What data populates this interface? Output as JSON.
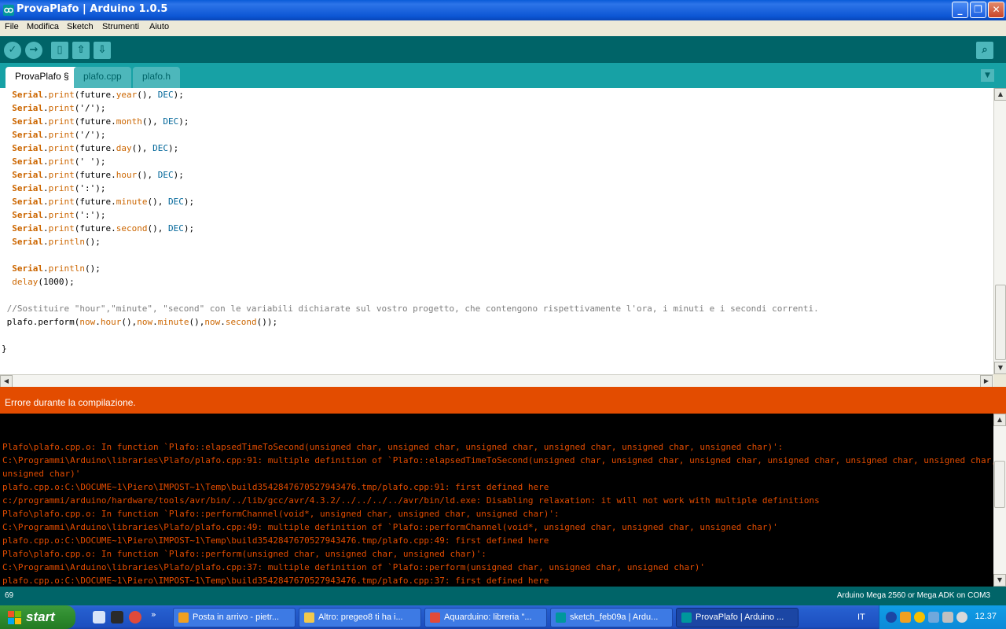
{
  "window": {
    "title": "ProvaPlafo | Arduino 1.0.5"
  },
  "menu": [
    "File",
    "Modifica",
    "Sketch",
    "Strumenti",
    "Aiuto"
  ],
  "tabs": [
    "ProvaPlafo §",
    "plafo.cpp",
    "plafo.h"
  ],
  "code_lines": [
    [
      {
        "t": "  "
      },
      {
        "t": "Serial",
        "c": "kw"
      },
      {
        "t": "."
      },
      {
        "t": "print",
        "c": "fn"
      },
      {
        "t": "(future."
      },
      {
        "t": "year",
        "c": "fn"
      },
      {
        "t": "(), "
      },
      {
        "t": "DEC",
        "c": "cst"
      },
      {
        "t": ");"
      }
    ],
    [
      {
        "t": "  "
      },
      {
        "t": "Serial",
        "c": "kw"
      },
      {
        "t": "."
      },
      {
        "t": "print",
        "c": "fn"
      },
      {
        "t": "('/');"
      }
    ],
    [
      {
        "t": "  "
      },
      {
        "t": "Serial",
        "c": "kw"
      },
      {
        "t": "."
      },
      {
        "t": "print",
        "c": "fn"
      },
      {
        "t": "(future."
      },
      {
        "t": "month",
        "c": "fn"
      },
      {
        "t": "(), "
      },
      {
        "t": "DEC",
        "c": "cst"
      },
      {
        "t": ");"
      }
    ],
    [
      {
        "t": "  "
      },
      {
        "t": "Serial",
        "c": "kw"
      },
      {
        "t": "."
      },
      {
        "t": "print",
        "c": "fn"
      },
      {
        "t": "('/');"
      }
    ],
    [
      {
        "t": "  "
      },
      {
        "t": "Serial",
        "c": "kw"
      },
      {
        "t": "."
      },
      {
        "t": "print",
        "c": "fn"
      },
      {
        "t": "(future."
      },
      {
        "t": "day",
        "c": "fn"
      },
      {
        "t": "(), "
      },
      {
        "t": "DEC",
        "c": "cst"
      },
      {
        "t": ");"
      }
    ],
    [
      {
        "t": "  "
      },
      {
        "t": "Serial",
        "c": "kw"
      },
      {
        "t": "."
      },
      {
        "t": "print",
        "c": "fn"
      },
      {
        "t": "(' ');"
      }
    ],
    [
      {
        "t": "  "
      },
      {
        "t": "Serial",
        "c": "kw"
      },
      {
        "t": "."
      },
      {
        "t": "print",
        "c": "fn"
      },
      {
        "t": "(future."
      },
      {
        "t": "hour",
        "c": "fn"
      },
      {
        "t": "(), "
      },
      {
        "t": "DEC",
        "c": "cst"
      },
      {
        "t": ");"
      }
    ],
    [
      {
        "t": "  "
      },
      {
        "t": "Serial",
        "c": "kw"
      },
      {
        "t": "."
      },
      {
        "t": "print",
        "c": "fn"
      },
      {
        "t": "(':');"
      }
    ],
    [
      {
        "t": "  "
      },
      {
        "t": "Serial",
        "c": "kw"
      },
      {
        "t": "."
      },
      {
        "t": "print",
        "c": "fn"
      },
      {
        "t": "(future."
      },
      {
        "t": "minute",
        "c": "fn"
      },
      {
        "t": "(), "
      },
      {
        "t": "DEC",
        "c": "cst"
      },
      {
        "t": ");"
      }
    ],
    [
      {
        "t": "  "
      },
      {
        "t": "Serial",
        "c": "kw"
      },
      {
        "t": "."
      },
      {
        "t": "print",
        "c": "fn"
      },
      {
        "t": "(':');"
      }
    ],
    [
      {
        "t": "  "
      },
      {
        "t": "Serial",
        "c": "kw"
      },
      {
        "t": "."
      },
      {
        "t": "print",
        "c": "fn"
      },
      {
        "t": "(future."
      },
      {
        "t": "second",
        "c": "fn"
      },
      {
        "t": "(), "
      },
      {
        "t": "DEC",
        "c": "cst"
      },
      {
        "t": ");"
      }
    ],
    [
      {
        "t": "  "
      },
      {
        "t": "Serial",
        "c": "kw"
      },
      {
        "t": "."
      },
      {
        "t": "println",
        "c": "fn"
      },
      {
        "t": "();"
      }
    ],
    [
      {
        "t": ""
      }
    ],
    [
      {
        "t": "  "
      },
      {
        "t": "Serial",
        "c": "kw"
      },
      {
        "t": "."
      },
      {
        "t": "println",
        "c": "fn"
      },
      {
        "t": "();"
      }
    ],
    [
      {
        "t": "  "
      },
      {
        "t": "delay",
        "c": "fn"
      },
      {
        "t": "(1000);"
      }
    ],
    [
      {
        "t": ""
      }
    ],
    [
      {
        "t": " "
      },
      {
        "t": "//Sostituire \"hour\",\"minute\", \"second\" con le variabili dichiarate sul vostro progetto, che contengono rispettivamente l'ora, i minuti e i secondi correnti.",
        "c": "cm"
      }
    ],
    [
      {
        "t": " plafo.perform("
      },
      {
        "t": "now",
        "c": "fn"
      },
      {
        "t": "."
      },
      {
        "t": "hour",
        "c": "fn"
      },
      {
        "t": "(),"
      },
      {
        "t": "now",
        "c": "fn"
      },
      {
        "t": "."
      },
      {
        "t": "minute",
        "c": "fn"
      },
      {
        "t": "(),"
      },
      {
        "t": "now",
        "c": "fn"
      },
      {
        "t": "."
      },
      {
        "t": "second",
        "c": "fn"
      },
      {
        "t": "());"
      }
    ],
    [
      {
        "t": ""
      }
    ],
    [
      {
        "t": "}"
      }
    ]
  ],
  "status": {
    "message": "Errore durante la compilazione."
  },
  "console_lines": [
    "",
    "",
    "Plafo\\plafo.cpp.o: In function `Plafo::elapsedTimeToSecond(unsigned char, unsigned char, unsigned char, unsigned char, unsigned char, unsigned char)':",
    "C:\\Programmi\\Arduino\\libraries\\Plafo/plafo.cpp:91: multiple definition of `Plafo::elapsedTimeToSecond(unsigned char, unsigned char, unsigned char, unsigned char, unsigned char, unsigned char,",
    "unsigned char)'",
    "plafo.cpp.o:C:\\DOCUME~1\\Piero\\IMPOST~1\\Temp\\build3542847670527943476.tmp/plafo.cpp:91: first defined here",
    "c:/programmi/arduino/hardware/tools/avr/bin/../lib/gcc/avr/4.3.2/../../../../avr/bin/ld.exe: Disabling relaxation: it will not work with multiple definitions",
    "Plafo\\plafo.cpp.o: In function `Plafo::performChannel(void*, unsigned char, unsigned char, unsigned char)':",
    "C:\\Programmi\\Arduino\\libraries\\Plafo/plafo.cpp:49: multiple definition of `Plafo::performChannel(void*, unsigned char, unsigned char, unsigned char)'",
    "plafo.cpp.o:C:\\DOCUME~1\\Piero\\IMPOST~1\\Temp\\build3542847670527943476.tmp/plafo.cpp:49: first defined here",
    "Plafo\\plafo.cpp.o: In function `Plafo::perform(unsigned char, unsigned char, unsigned char)':",
    "C:\\Programmi\\Arduino\\libraries\\Plafo/plafo.cpp:37: multiple definition of `Plafo::perform(unsigned char, unsigned char, unsigned char)'",
    "plafo.cpp.o:C:\\DOCUME~1\\Piero\\IMPOST~1\\Temp\\build3542847670527943476.tmp/plafo.cpp:37: first defined here"
  ],
  "footer": {
    "line_number": "69",
    "board": "Arduino Mega 2560 or Mega ADK on COM3"
  },
  "taskbar": {
    "start_label": "start",
    "tasks": [
      {
        "label": "Posta in arrivo - pietr...",
        "icon": "outlook-icon",
        "color": "#f0a020"
      },
      {
        "label": "Altro: pregeo8 ti ha i...",
        "icon": "mail-icon",
        "color": "#f2c94c"
      },
      {
        "label": "Aquarduino: libreria \"...",
        "icon": "chrome-icon",
        "color": "#e04a3a"
      },
      {
        "label": "sketch_feb09a | Ardu...",
        "icon": "arduino-icon",
        "color": "#00979c"
      },
      {
        "label": "ProvaPlafo | Arduino ...",
        "icon": "arduino-icon",
        "color": "#00979c"
      }
    ],
    "language": "IT",
    "clock": "12.37"
  }
}
